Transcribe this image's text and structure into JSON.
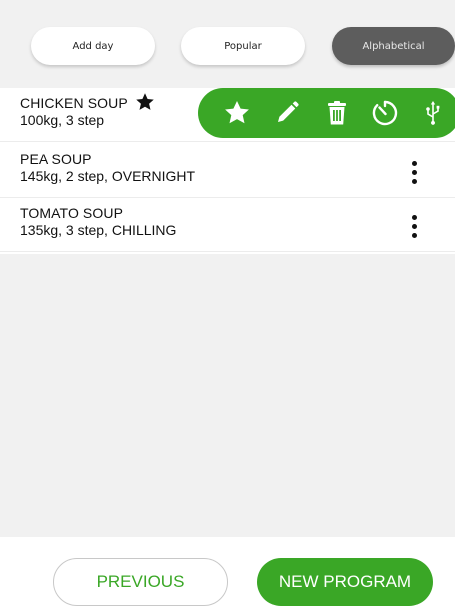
{
  "tabs": {
    "add_day": "Add day",
    "popular": "Popular",
    "alphabetical": "Alphabetical",
    "selected": "Alphabetical"
  },
  "programs": [
    {
      "name": "CHICKEN SOUP",
      "details": "100kg, 3 step",
      "favorite": true
    },
    {
      "name": "PEA SOUP",
      "details": "145kg, 2 step, OVERNIGHT",
      "favorite": false
    },
    {
      "name": "TOMATO SOUP",
      "details": "135kg, 3 step, CHILLING",
      "favorite": false
    }
  ],
  "row_actions": [
    "star-icon",
    "pencil-icon",
    "trash-icon",
    "timer-icon",
    "usb-icon"
  ],
  "buttons": {
    "previous": "PREVIOUS",
    "new_program": "NEW PROGRAM"
  },
  "colors": {
    "accent": "#3aa726",
    "selected_tab": "#5d5d5d",
    "background": "#f1f1f1"
  }
}
